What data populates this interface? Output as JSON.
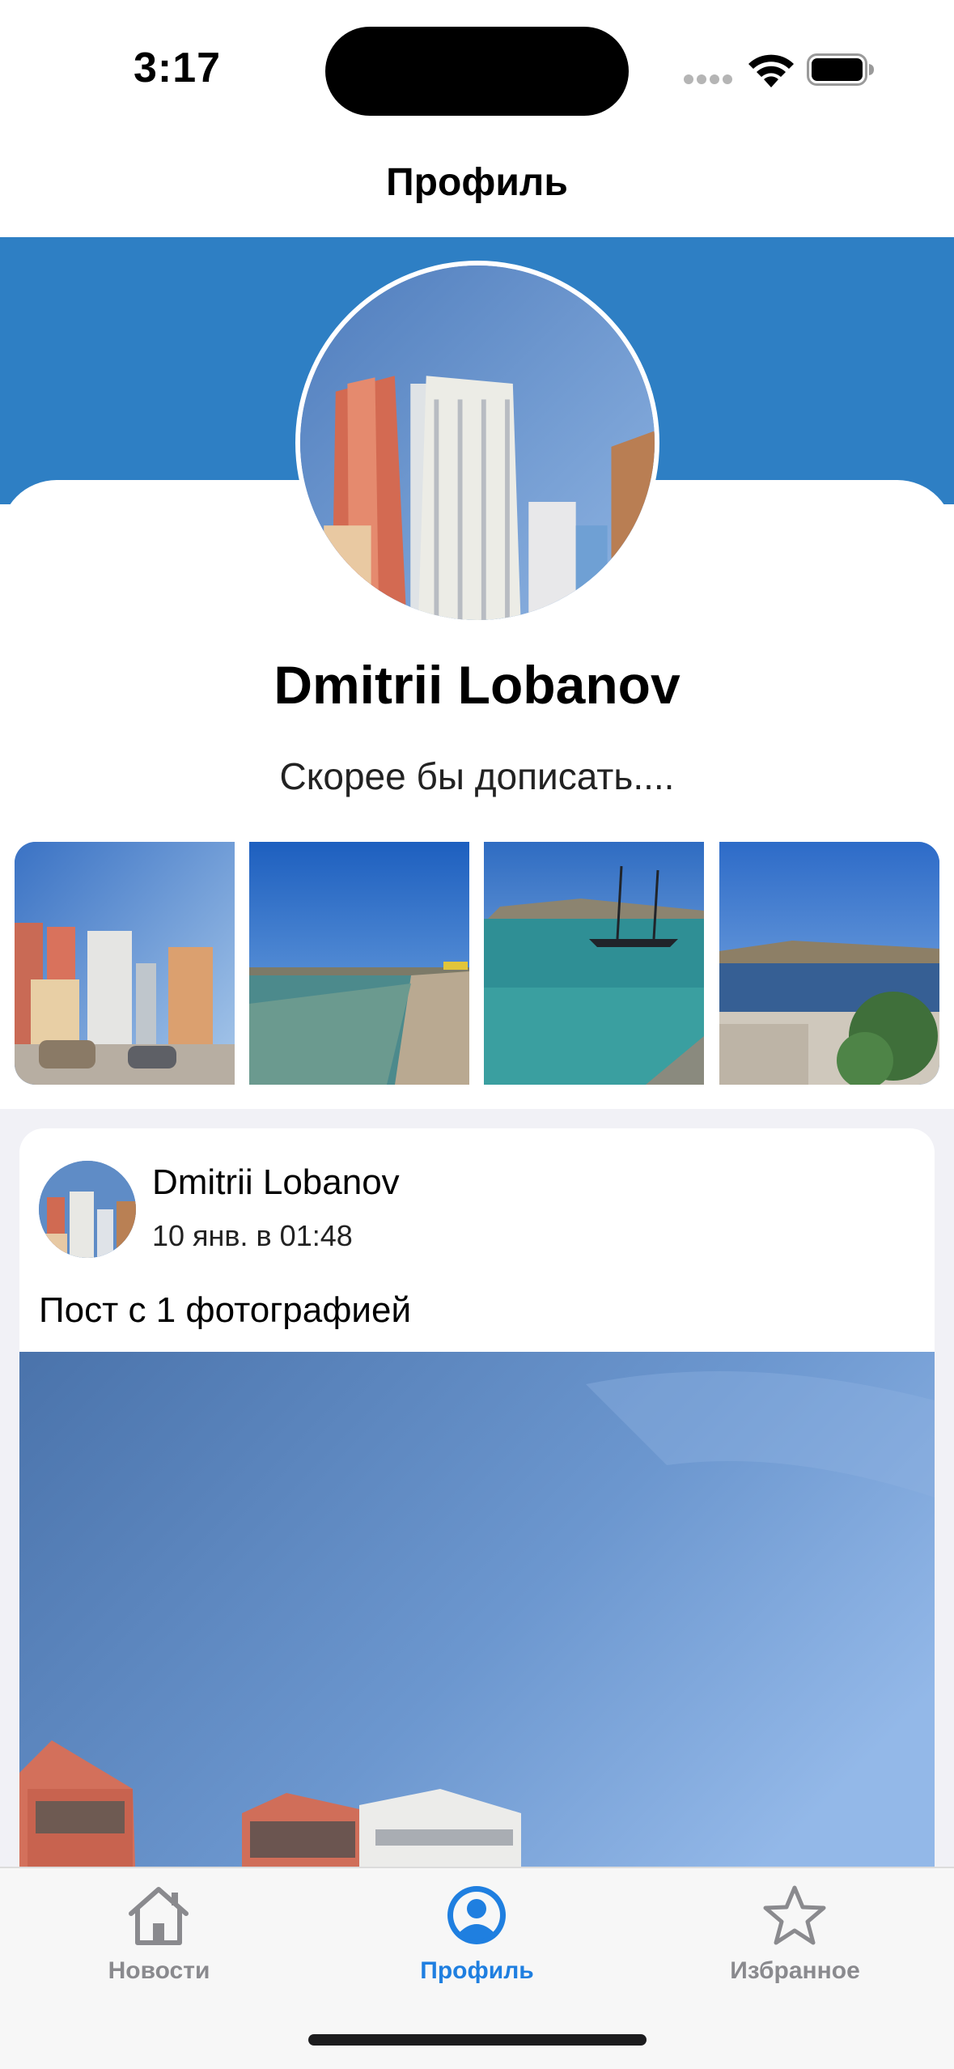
{
  "status_bar": {
    "time": "3:17",
    "icons": [
      "signal-dots-icon",
      "wifi-icon",
      "battery-icon"
    ]
  },
  "navigation": {
    "title": "Профиль"
  },
  "profile": {
    "name": "Dmitrii Lobanov",
    "status": "Скорее бы дописать....",
    "header_color": "#2e7fc4",
    "photos": [
      {
        "name": "city-buildings-photo"
      },
      {
        "name": "beach-shore-photo"
      },
      {
        "name": "sailboat-harbor-photo"
      },
      {
        "name": "bay-view-photo"
      }
    ]
  },
  "post": {
    "author": "Dmitrii Lobanov",
    "date": "10 янв. в 01:48",
    "text": "Пост с 1 фотографией"
  },
  "tab_bar": {
    "tabs": [
      {
        "label": "Новости",
        "icon": "house-icon",
        "active": false
      },
      {
        "label": "Профиль",
        "icon": "person-circle-icon",
        "active": true
      },
      {
        "label": "Избранное",
        "icon": "star-icon",
        "active": false
      }
    ],
    "active_color": "#1f7fe0",
    "inactive_color": "#8a8a8e"
  }
}
